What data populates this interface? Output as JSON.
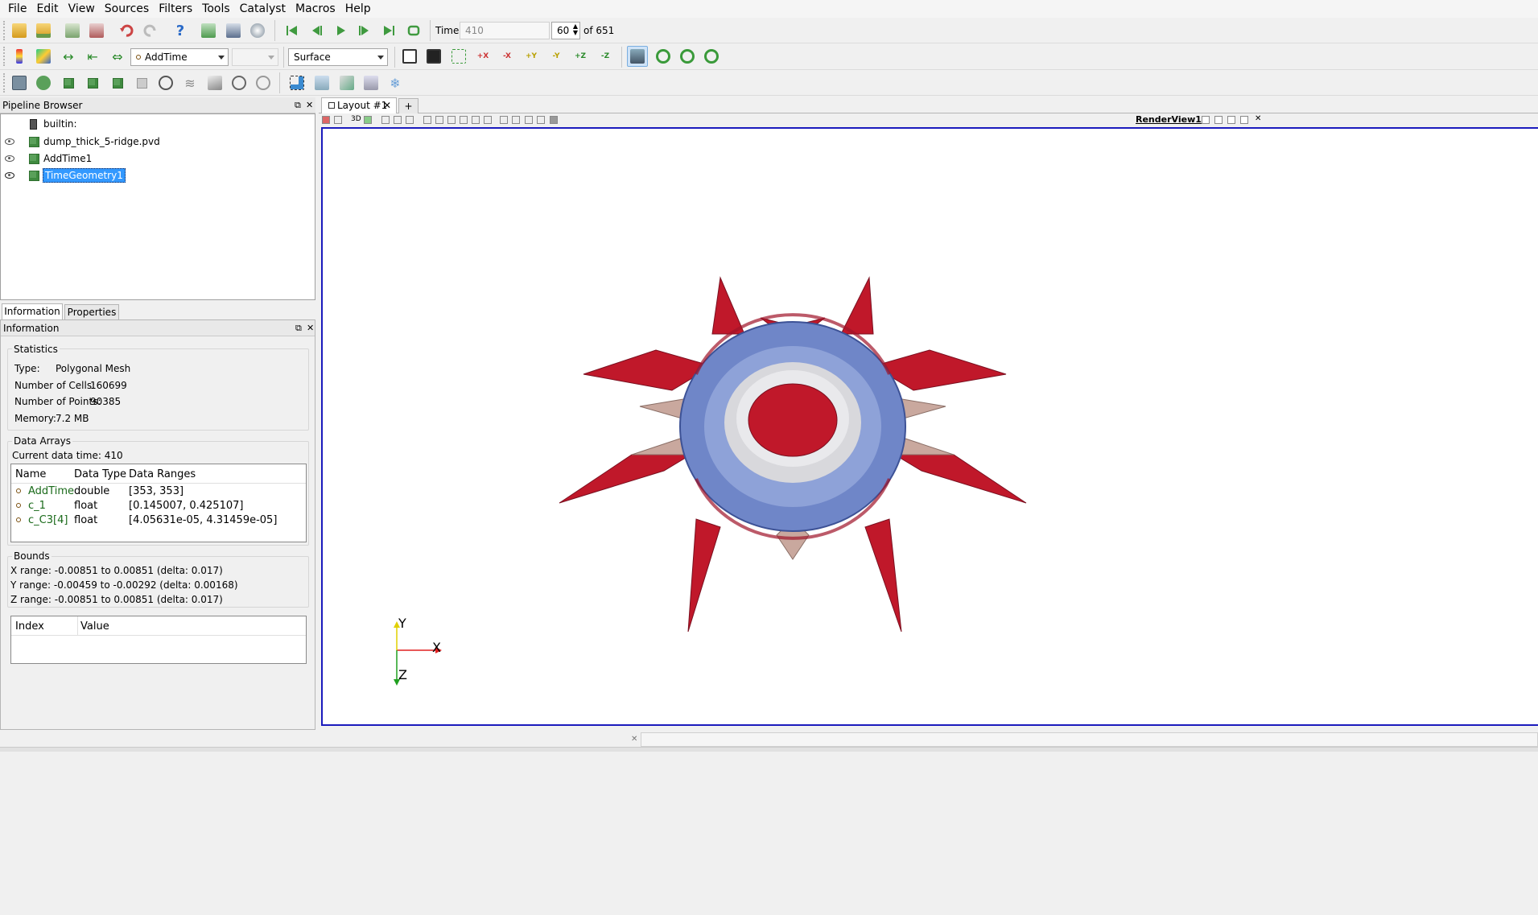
{
  "menu": [
    "File",
    "Edit",
    "View",
    "Sources",
    "Filters",
    "Tools",
    "Catalyst",
    "Macros",
    "Help"
  ],
  "time": {
    "label": "Time:",
    "value": "410",
    "step": "60",
    "of_label": "of 651"
  },
  "toolbar": {
    "active_source": "AddTime",
    "representation": "Surface",
    "camera_labels": [
      "+X",
      "-X",
      "+Y",
      "-Y",
      "+Z",
      "-Z"
    ]
  },
  "pipeline": {
    "title": "Pipeline Browser",
    "items": [
      {
        "label": "builtin:"
      },
      {
        "label": "dump_thick_5-ridge.pvd"
      },
      {
        "label": "AddTime1"
      },
      {
        "label": "TimeGeometry1"
      }
    ]
  },
  "info_tabs": {
    "information": "Information",
    "properties": "Properties"
  },
  "information": {
    "title": "Information",
    "statistics": {
      "title": "Statistics",
      "type_label": "Type:",
      "type_value": "Polygonal Mesh",
      "cells_label": "Number of Cells:",
      "cells_value": "160699",
      "points_label": "Number of Points:",
      "points_value": "90385",
      "memory_label": "Memory:",
      "memory_value": "7.2 MB"
    },
    "data_arrays": {
      "title": "Data Arrays",
      "current_time": "Current data time: 410",
      "headers": [
        "Name",
        "Data Type",
        "Data Ranges"
      ],
      "rows": [
        {
          "name": "AddTime",
          "type": "double",
          "range": "[353, 353]"
        },
        {
          "name": "c_1",
          "type": "float",
          "range": "[0.145007, 0.425107]"
        },
        {
          "name": "c_C3[4]",
          "type": "float",
          "range": "[4.05631e-05, 4.31459e-05]"
        }
      ]
    },
    "bounds": {
      "title": "Bounds",
      "x": "X range:  -0.00851 to 0.00851 (delta: 0.017)",
      "y": "Y range:  -0.00459 to -0.00292 (delta: 0.00168)",
      "z": "Z range:  -0.00851 to 0.00851 (delta: 0.017)"
    },
    "field_table": {
      "headers": [
        "Index",
        "Value"
      ]
    }
  },
  "layout": {
    "tab_label": "Layout #1",
    "add_label": "+",
    "view_mode": "3D",
    "view_name": "RenderView1"
  },
  "axes": {
    "x": "X",
    "y": "Y",
    "z": "Z"
  },
  "colors": {
    "selection": "#3399ff",
    "render_border": "#1b1bbd",
    "mesh_red": "#c0182a",
    "mesh_blue": "#6f86c8",
    "mesh_light": "#d8d8dc"
  }
}
